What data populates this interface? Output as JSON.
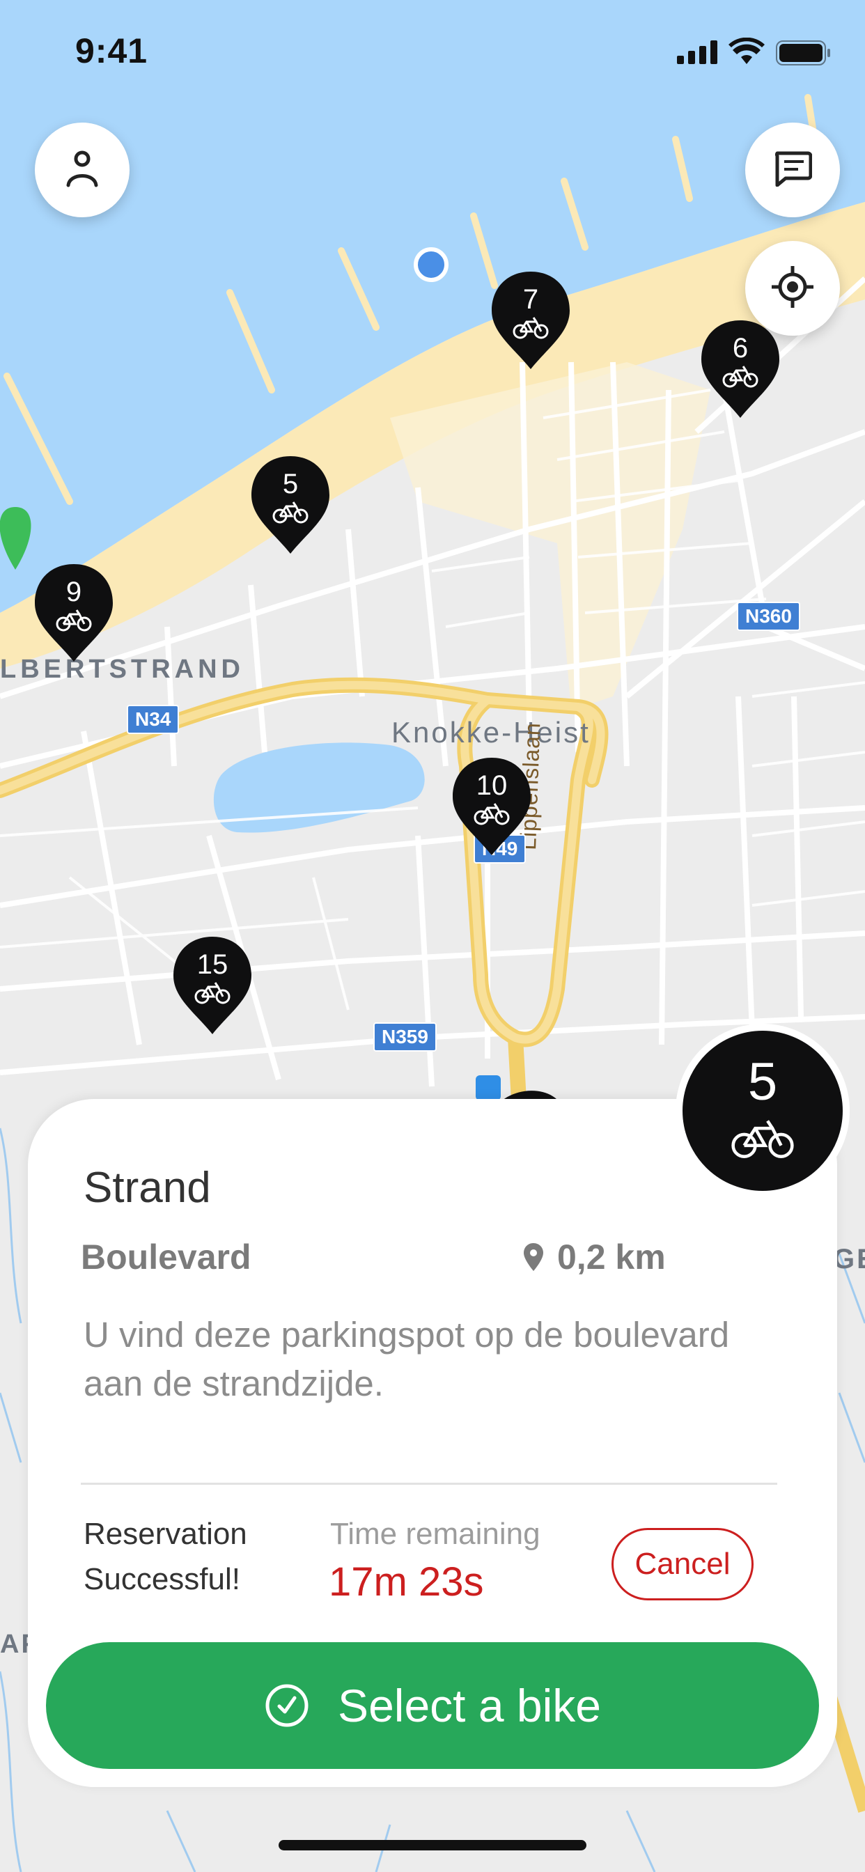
{
  "status_bar": {
    "time": "9:41"
  },
  "map": {
    "place_labels": {
      "albertstrand": "LBERTSTRAND",
      "knokke_heist": "Knokke-Heist",
      "lippenslaan": "Lippenslaan",
      "edge_left": "AF",
      "edge_right": "GE"
    },
    "road_badges": [
      "N34",
      "N360",
      "N359",
      "N49"
    ],
    "markers": [
      {
        "count": "7",
        "icon": "bike-icon"
      },
      {
        "count": "6",
        "icon": "bike-icon"
      },
      {
        "count": "5",
        "icon": "bike-icon"
      },
      {
        "count": "9",
        "icon": "bike-icon"
      },
      {
        "count": "10",
        "icon": "bike-icon"
      },
      {
        "count": "15",
        "icon": "bike-icon"
      }
    ],
    "colors": {
      "sea": "#a9d6fb",
      "beach": "#fbe9b7",
      "land": "#ececec",
      "highway": "#f7d780",
      "marker": "#0f0f10",
      "user_location": "#4a8fe6"
    }
  },
  "buttons": {
    "profile": "person-icon",
    "chat": "chat-icon",
    "locate": "locate-icon"
  },
  "selected_station": {
    "count": "5",
    "name": "Strand",
    "street": "Boulevard",
    "distance": "0,2 km",
    "description": "U vind deze parkingspot op de boulevard aan de strandzijde."
  },
  "reservation": {
    "status": "Reservation Successful!",
    "time_label": "Time remaining",
    "time_value": "17m 23s",
    "cancel_label": "Cancel"
  },
  "cta": {
    "label": "Select a bike",
    "color": "#27a85a"
  },
  "accent": {
    "danger": "#cc1f1f"
  }
}
